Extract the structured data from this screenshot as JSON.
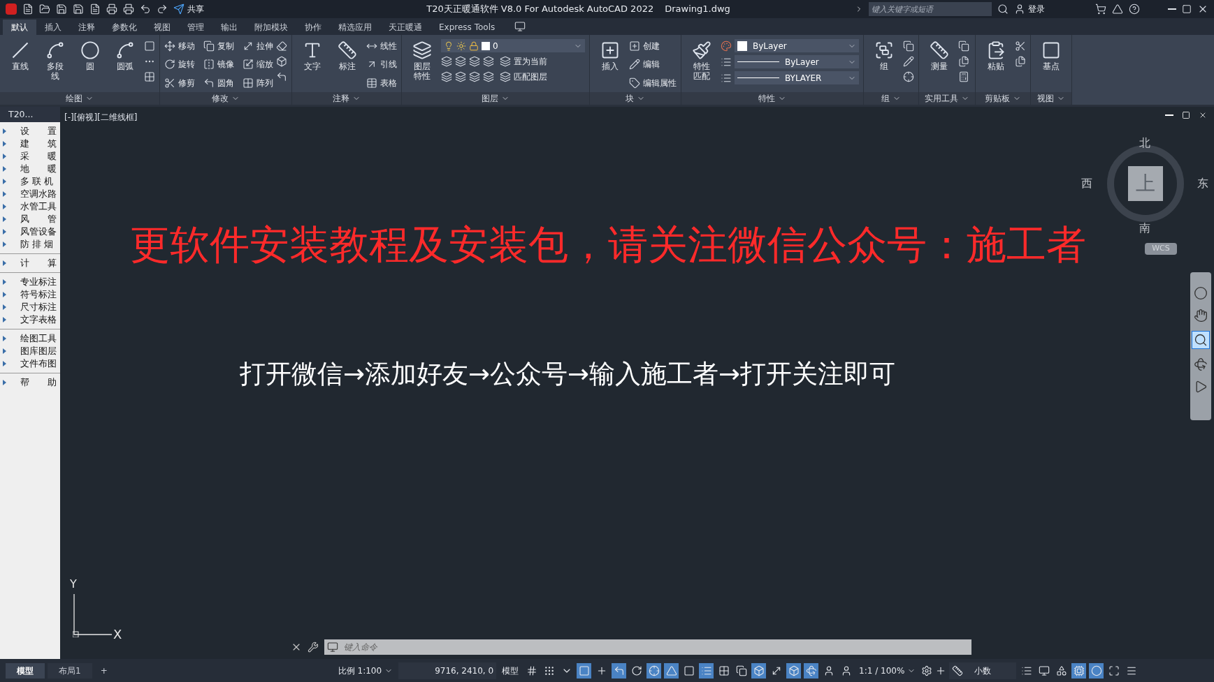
{
  "title_bar": {
    "share": "共享",
    "title": "T20天正暖通软件 V8.0 For Autodesk AutoCAD 2022",
    "file": "Drawing1.dwg",
    "search_placeholder": "键入关键字或短语",
    "login": "登录"
  },
  "ribbon_tabs": [
    {
      "label": "默认",
      "selected": true
    },
    {
      "label": "插入",
      "selected": false
    },
    {
      "label": "注释",
      "selected": false
    },
    {
      "label": "参数化",
      "selected": false
    },
    {
      "label": "视图",
      "selected": false
    },
    {
      "label": "管理",
      "selected": false
    },
    {
      "label": "输出",
      "selected": false
    },
    {
      "label": "附加模块",
      "selected": false
    },
    {
      "label": "协作",
      "selected": false
    },
    {
      "label": "精选应用",
      "selected": false
    },
    {
      "label": "天正暖通",
      "selected": false
    },
    {
      "label": "Express Tools",
      "selected": false
    }
  ],
  "panels": [
    {
      "title": "绘图",
      "large": [
        "直线",
        "多段线",
        "圆",
        "圆弧"
      ]
    },
    {
      "title": "修改",
      "small": [
        "移动",
        "旋转",
        "修剪",
        "复制",
        "镜像",
        "圆角",
        "拉伸",
        "缩放",
        "阵列"
      ]
    },
    {
      "title": "注释",
      "large": [
        "文字",
        "标注"
      ],
      "small": [
        "线性",
        "引线",
        "表格"
      ]
    },
    {
      "title": "图层",
      "large": [
        "图层特性"
      ],
      "layer": "0",
      "small": [
        "置为当前",
        "匹配图层"
      ]
    },
    {
      "title": "块",
      "large": [
        "插入"
      ],
      "small": [
        "创建",
        "编辑",
        "编辑属性"
      ]
    },
    {
      "title": "特性",
      "large": [
        "特性匹配"
      ],
      "combos": [
        "ByLayer",
        "ByLayer",
        "BYLAYER"
      ]
    },
    {
      "title": "组",
      "large": [
        "组"
      ]
    },
    {
      "title": "实用工具",
      "large": [
        "测量"
      ]
    },
    {
      "title": "剪贴板",
      "large": [
        "粘贴"
      ]
    },
    {
      "title": "视图",
      "large": [
        "基点"
      ]
    }
  ],
  "sidebar": {
    "header": "T20...",
    "groups": [
      [
        "设　　置",
        "建　　筑",
        "采　　暖",
        "地　　暖",
        "多 联 机",
        "空调水路",
        "水管工具",
        "风　　管",
        "风管设备",
        "防 排 烟"
      ],
      [
        "计　　算"
      ],
      [
        "专业标注",
        "符号标注",
        "尺寸标注",
        "文字表格"
      ],
      [
        "绘图工具",
        "图库图层",
        "文件布图"
      ],
      [
        "帮　　助"
      ]
    ]
  },
  "viewport": {
    "label": "[-][俯视][二维线框]"
  },
  "viewcube": {
    "north": "北",
    "south": "南",
    "east": "东",
    "west": "西",
    "top": "上",
    "wcs": "WCS"
  },
  "ucs": {
    "x": "X",
    "y": "Y"
  },
  "canvas_texts": [
    {
      "text": "更软件安装教程及安装包，请关注微信公众号：施工者",
      "color": "#ff2a2a"
    },
    {
      "text": "打开微信→添加好友→公众号→输入施工者→打开关注即可",
      "color": "#ffffff"
    }
  ],
  "command_line": {
    "placeholder": "键入命令"
  },
  "layout_tabs": [
    {
      "label": "模型",
      "selected": true
    },
    {
      "label": "布局1",
      "selected": false
    }
  ],
  "add_tab": "+",
  "status_bar": {
    "scale": "比例 1:100",
    "coords": "9716, 2410, 0",
    "space": "模型",
    "toggles_left": [
      {
        "on": false
      },
      {
        "on": false
      },
      {
        "on": false
      },
      {
        "on": true
      },
      {
        "on": false
      },
      {
        "on": true
      },
      {
        "on": false
      },
      {
        "on": true
      },
      {
        "on": true
      },
      {
        "on": false
      },
      {
        "on": true
      },
      {
        "on": false
      },
      {
        "on": false
      },
      {
        "on": true
      },
      {
        "on": false
      },
      {
        "on": true
      },
      {
        "on": true
      },
      {
        "on": false
      },
      {
        "on": false
      }
    ],
    "annotation_scale": "1:1 / 100%",
    "units": "小数",
    "toggles_right": [
      {
        "on": false
      },
      {
        "on": false
      },
      {
        "on": false
      },
      {
        "on": true
      },
      {
        "on": true
      },
      {
        "on": false
      },
      {
        "on": false
      }
    ]
  }
}
